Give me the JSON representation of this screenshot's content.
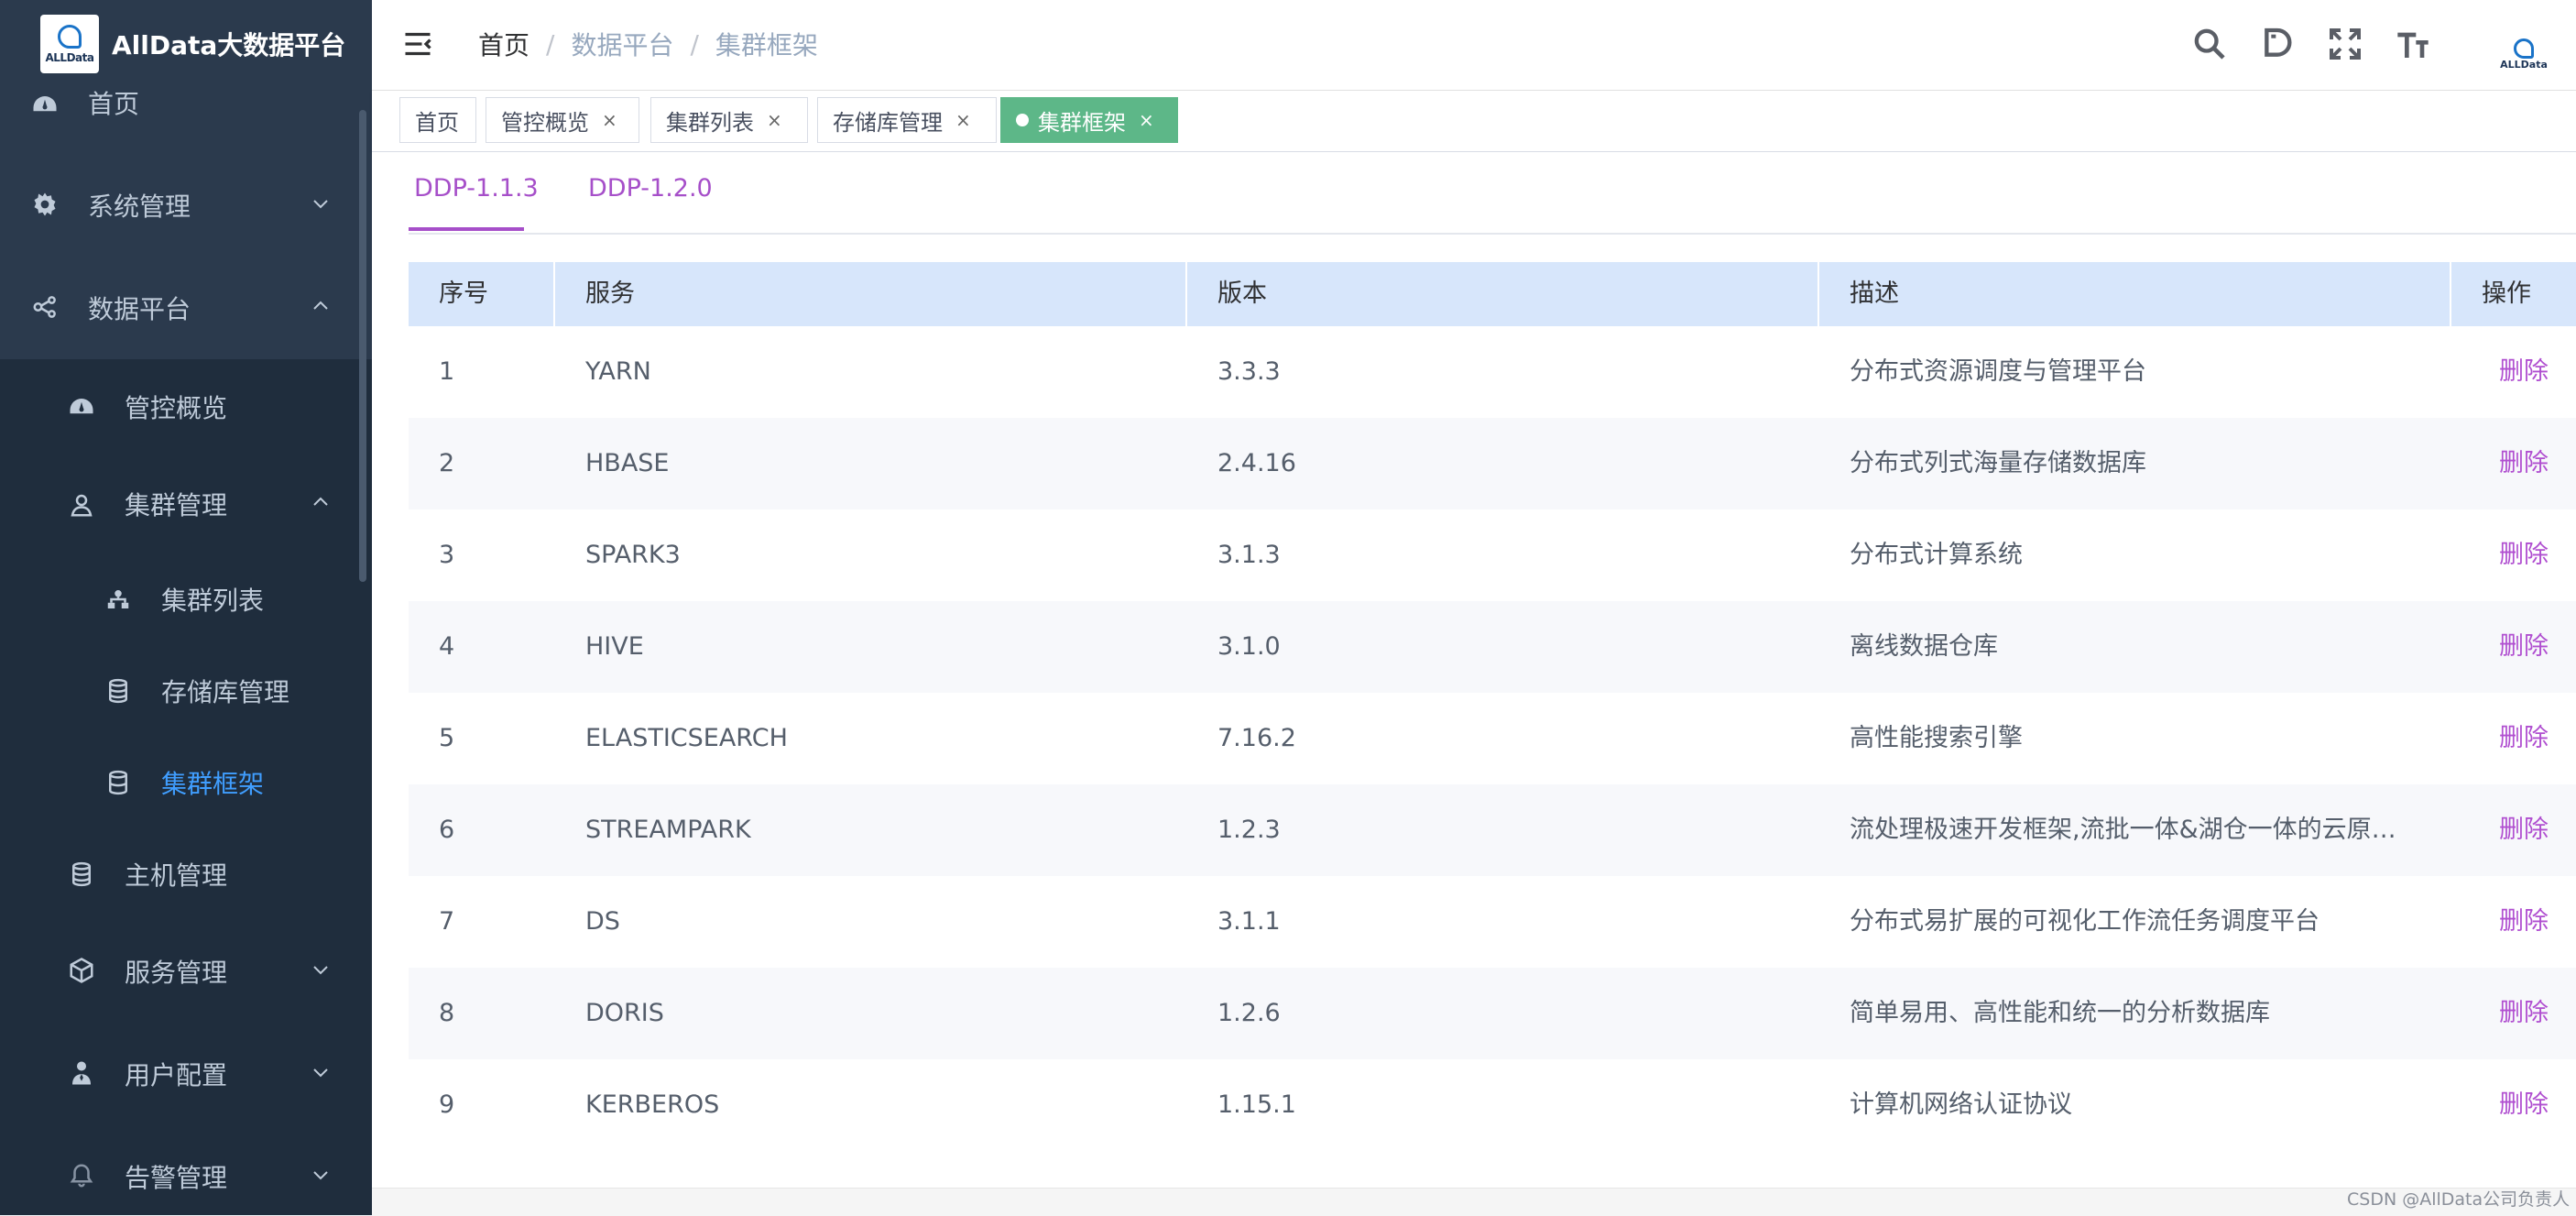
{
  "app": {
    "logo_text": "ALLData",
    "title": "AllData大数据平台"
  },
  "sidebar": {
    "items": [
      {
        "label": "首页",
        "icon": "dashboard-icon"
      },
      {
        "label": "系统管理",
        "icon": "gear-icon"
      },
      {
        "label": "数据平台",
        "icon": "share-nodes-icon"
      },
      {
        "label": "管控概览",
        "icon": "dashboard-icon"
      },
      {
        "label": "集群管理",
        "icon": "user-icon"
      },
      {
        "label": "集群列表",
        "icon": "cluster-icon"
      },
      {
        "label": "存储库管理",
        "icon": "database-list-icon"
      },
      {
        "label": "集群框架",
        "icon": "database-icon"
      },
      {
        "label": "主机管理",
        "icon": "server-icon"
      },
      {
        "label": "服务管理",
        "icon": "cube-icon"
      },
      {
        "label": "用户配置",
        "icon": "user-config-icon"
      },
      {
        "label": "告警管理",
        "icon": "bell-icon"
      }
    ]
  },
  "header": {
    "breadcrumb": [
      "首页",
      "数据平台",
      "集群框架"
    ],
    "separator": "/",
    "avatar_text": "ALLData"
  },
  "tags": [
    {
      "label": "首页"
    },
    {
      "label": "管控概览",
      "close": "×"
    },
    {
      "label": "集群列表",
      "close": "×"
    },
    {
      "label": "存储库管理",
      "close": "×"
    },
    {
      "label": "集群框架",
      "close": "×"
    }
  ],
  "tabs": [
    "DDP-1.1.3",
    "DDP-1.2.0"
  ],
  "table": {
    "columns": [
      "序号",
      "服务",
      "版本",
      "描述",
      "操作"
    ],
    "rows": [
      {
        "no": "1",
        "service": "YARN",
        "version": "3.3.3",
        "desc": "分布式资源调度与管理平台",
        "op": "删除"
      },
      {
        "no": "2",
        "service": "HBASE",
        "version": "2.4.16",
        "desc": "分布式列式海量存储数据库",
        "op": "删除"
      },
      {
        "no": "3",
        "service": "SPARK3",
        "version": "3.1.3",
        "desc": "分布式计算系统",
        "op": "删除"
      },
      {
        "no": "4",
        "service": "HIVE",
        "version": "3.1.0",
        "desc": "离线数据仓库",
        "op": "删除"
      },
      {
        "no": "5",
        "service": "ELASTICSEARCH",
        "version": "7.16.2",
        "desc": "高性能搜索引擎",
        "op": "删除"
      },
      {
        "no": "6",
        "service": "STREAMPARK",
        "version": "1.2.3",
        "desc": "流处理极速开发框架,流批一体&湖仓一体的云原…",
        "op": "删除"
      },
      {
        "no": "7",
        "service": "DS",
        "version": "3.1.1",
        "desc": "分布式易扩展的可视化工作流任务调度平台",
        "op": "删除"
      },
      {
        "no": "8",
        "service": "DORIS",
        "version": "1.2.6",
        "desc": "简单易用、高性能和统一的分析数据库",
        "op": "删除"
      },
      {
        "no": "9",
        "service": "KERBEROS",
        "version": "1.15.1",
        "desc": "计算机网络认证协议",
        "op": "删除"
      }
    ]
  },
  "watermark": "CSDN @AllData公司负责人",
  "colors": {
    "sidebar_bg": "#2b3a4d",
    "submenu_bg": "#1f2d3d",
    "active_menu": "#409eff",
    "tab_accent": "#a64fc9",
    "active_tag": "#5db788",
    "table_header": "#d7e6fb"
  }
}
